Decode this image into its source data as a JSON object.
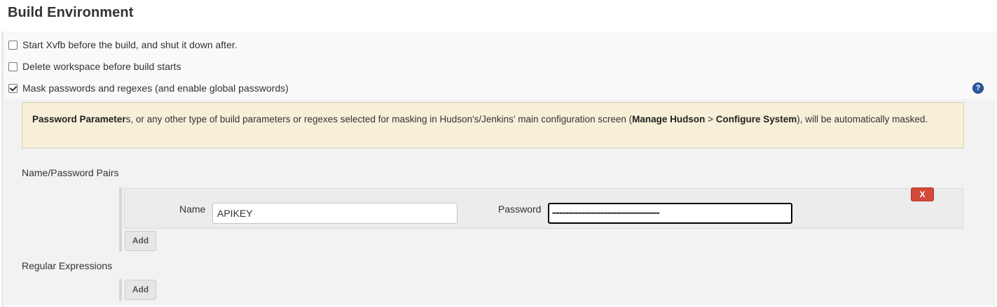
{
  "section": {
    "title": "Build Environment"
  },
  "options": [
    {
      "label": "Start Xvfb before the build, and shut it down after.",
      "checked": false
    },
    {
      "label": "Delete workspace before build starts",
      "checked": false
    },
    {
      "label": "Mask passwords and regexes (and enable global passwords)",
      "checked": true
    }
  ],
  "help_icon": "?",
  "info": {
    "bold1": "Password Parameter",
    "text1": "s, or any other type of build parameters or regexes selected for masking in Hudson's/Jenkins' main configuration screen (",
    "bold2": "Manage Hudson",
    "text2": " > ",
    "bold3": "Configure System",
    "text3": "), will be automatically masked."
  },
  "pairs": {
    "heading": "Name/Password Pairs",
    "name_label": "Name",
    "name_value": "APIKEY",
    "password_label": "Password",
    "password_mask": "••••••••••••••••••••••••••••••••••••••••••••••••••••••••••••",
    "delete_label": "X",
    "add_label": "Add"
  },
  "regex": {
    "heading": "Regular Expressions",
    "add_label": "Add"
  }
}
